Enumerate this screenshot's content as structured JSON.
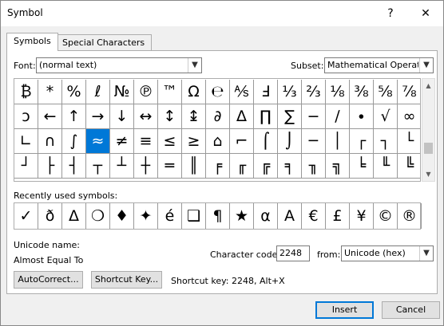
{
  "window": {
    "title": "Symbol",
    "help": "?",
    "close": "✕"
  },
  "tabs": [
    {
      "label": "Symbols"
    },
    {
      "label": "Special Characters"
    }
  ],
  "font": {
    "label": "Font:",
    "value": "(normal text)"
  },
  "subset": {
    "label": "Subset:",
    "value": "Mathematical Operators"
  },
  "grid": [
    [
      "₿",
      "*",
      "%",
      "ℓ",
      "№",
      "℗",
      "™",
      "Ω",
      "℮",
      "⅍",
      "Ⅎ",
      "⅓",
      "⅔",
      "⅛",
      "⅜",
      "⅝",
      "⅞"
    ],
    [
      "ↄ",
      "←",
      "↑",
      "→",
      "↓",
      "↔",
      "↕",
      "↨",
      "∂",
      "∆",
      "∏",
      "∑",
      "−",
      "∕",
      "∙",
      "√",
      "∞"
    ],
    [
      "∟",
      "∩",
      "∫",
      "≈",
      "≠",
      "≡",
      "≤",
      "≥",
      "⌂",
      "⌐",
      "⌠",
      "⌡",
      "─",
      "│",
      "┌",
      "┐",
      "└"
    ],
    [
      "┘",
      "├",
      "┤",
      "┬",
      "┴",
      "┼",
      "═",
      "║",
      "╒",
      "╓",
      "╔",
      "╕",
      "╖",
      "╗",
      "╘",
      "╙",
      "╚"
    ]
  ],
  "selected": {
    "row": 2,
    "col": 3
  },
  "recent": {
    "label": "Recently used symbols:",
    "symbols": [
      "✓",
      "ð",
      "Δ",
      "❍",
      "♦",
      "✦",
      "é",
      "❑",
      "¶",
      "★",
      "α",
      "A",
      "€",
      "£",
      "¥",
      "©",
      "®"
    ]
  },
  "unicode_name": {
    "label": "Unicode name:",
    "value": "Almost Equal To"
  },
  "char_code": {
    "label": "Character code:",
    "value": "2248"
  },
  "from": {
    "label": "from:",
    "value": "Unicode (hex)"
  },
  "buttons": {
    "autocorrect": "AutoCorrect...",
    "shortcut_key": "Shortcut Key...",
    "insert": "Insert",
    "cancel": "Cancel"
  },
  "shortcut_info": "Shortcut key: 2248, Alt+X"
}
